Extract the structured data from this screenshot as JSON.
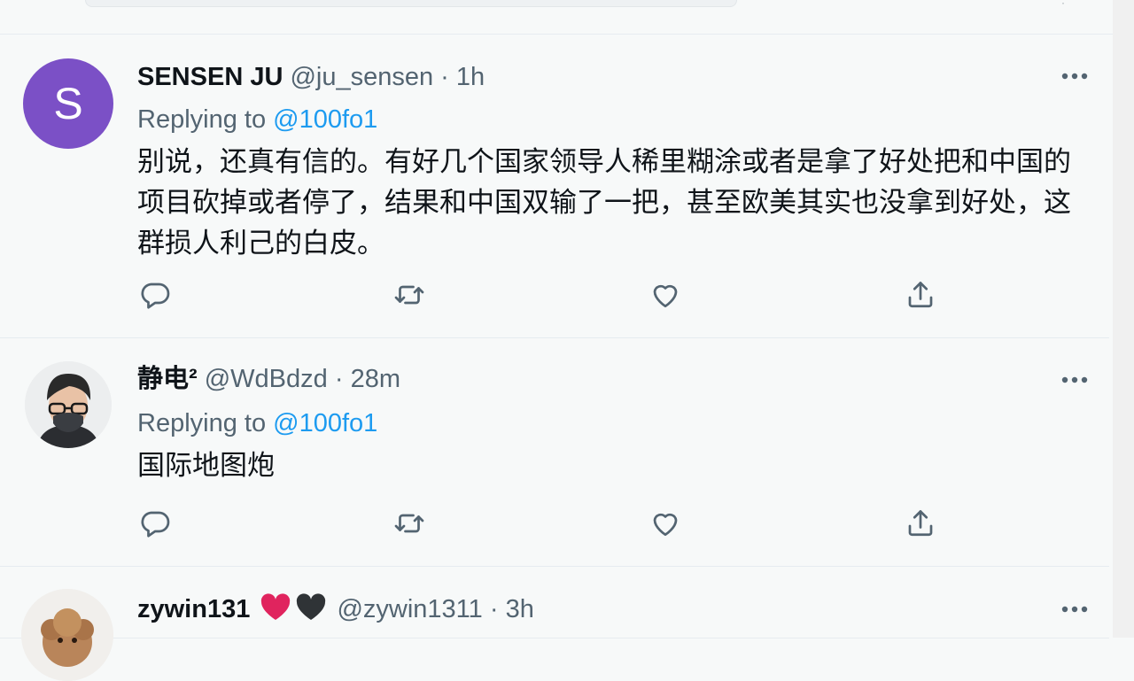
{
  "colors": {
    "background": "#f7f9f9",
    "text": "#0f1419",
    "secondary_text": "#536471",
    "link": "#1d9bf0",
    "avatar_s": "#7b50c6"
  },
  "tweets": [
    {
      "avatar_letter": "S",
      "display_name": "SENSEN JU",
      "handle": "@ju_sensen",
      "separator": "·",
      "time": "1h",
      "replying_prefix": "Replying to",
      "replying_to": "@100fo1",
      "text": "别说，还真有信的。有好几个国家领导人稀里糊涂或者是拿了好处把和中国的项目砍掉或者停了，结果和中国双输了一把，甚至欧美其实也没拿到好处，这群损人利己的白皮。",
      "actions": [
        "reply-icon",
        "retweet-icon",
        "like-icon",
        "share-icon"
      ]
    },
    {
      "display_name": "静电²",
      "handle": "@WdBdzd",
      "separator": "·",
      "time": "28m",
      "replying_prefix": "Replying to",
      "replying_to": "@100fo1",
      "text": "国际地图炮",
      "actions": [
        "reply-icon",
        "retweet-icon",
        "like-icon",
        "share-icon"
      ]
    },
    {
      "display_name": "zywin131",
      "handle": "@zywin1311",
      "separator": "·",
      "time": "3h"
    }
  ]
}
